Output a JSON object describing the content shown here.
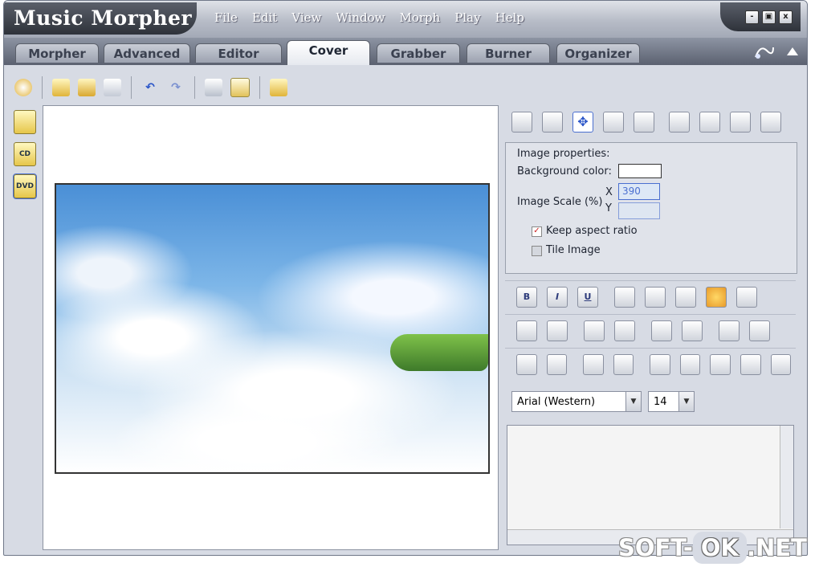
{
  "app": {
    "title": "Music Morpher"
  },
  "menu": [
    "File",
    "Edit",
    "View",
    "Window",
    "Morph",
    "Play",
    "Help"
  ],
  "window_controls": {
    "minimize": "-",
    "maximize": "▣",
    "close": "x"
  },
  "tabs": [
    {
      "label": "Morpher",
      "active": false
    },
    {
      "label": "Advanced",
      "active": false
    },
    {
      "label": "Editor",
      "active": false
    },
    {
      "label": "Cover",
      "active": true
    },
    {
      "label": "Grabber",
      "active": false
    },
    {
      "label": "Burner",
      "active": false
    },
    {
      "label": "Organizer",
      "active": false
    }
  ],
  "left_toolbar": [
    {
      "label": "CD",
      "icon": "cd-label-icon"
    },
    {
      "label": "DVD",
      "icon": "dvd-label-icon"
    }
  ],
  "image_properties": {
    "header": "Image properties:",
    "background_color_label": "Background color:",
    "background_color": "#ffffff",
    "scale_label": "Image Scale (%)",
    "x_label": "X",
    "y_label": "Y",
    "x_value": "390",
    "y_value": "",
    "keep_aspect": {
      "label": "Keep aspect ratio",
      "checked": true
    },
    "tile_image": {
      "label": "Tile Image",
      "checked": false
    }
  },
  "format_rows": {
    "row1": [
      "B",
      "I",
      "U"
    ]
  },
  "font": {
    "family": "Arial (Western)",
    "size": "14"
  },
  "watermark": {
    "left": "SOFT-",
    "ok": "OK",
    "right": ".NET"
  }
}
